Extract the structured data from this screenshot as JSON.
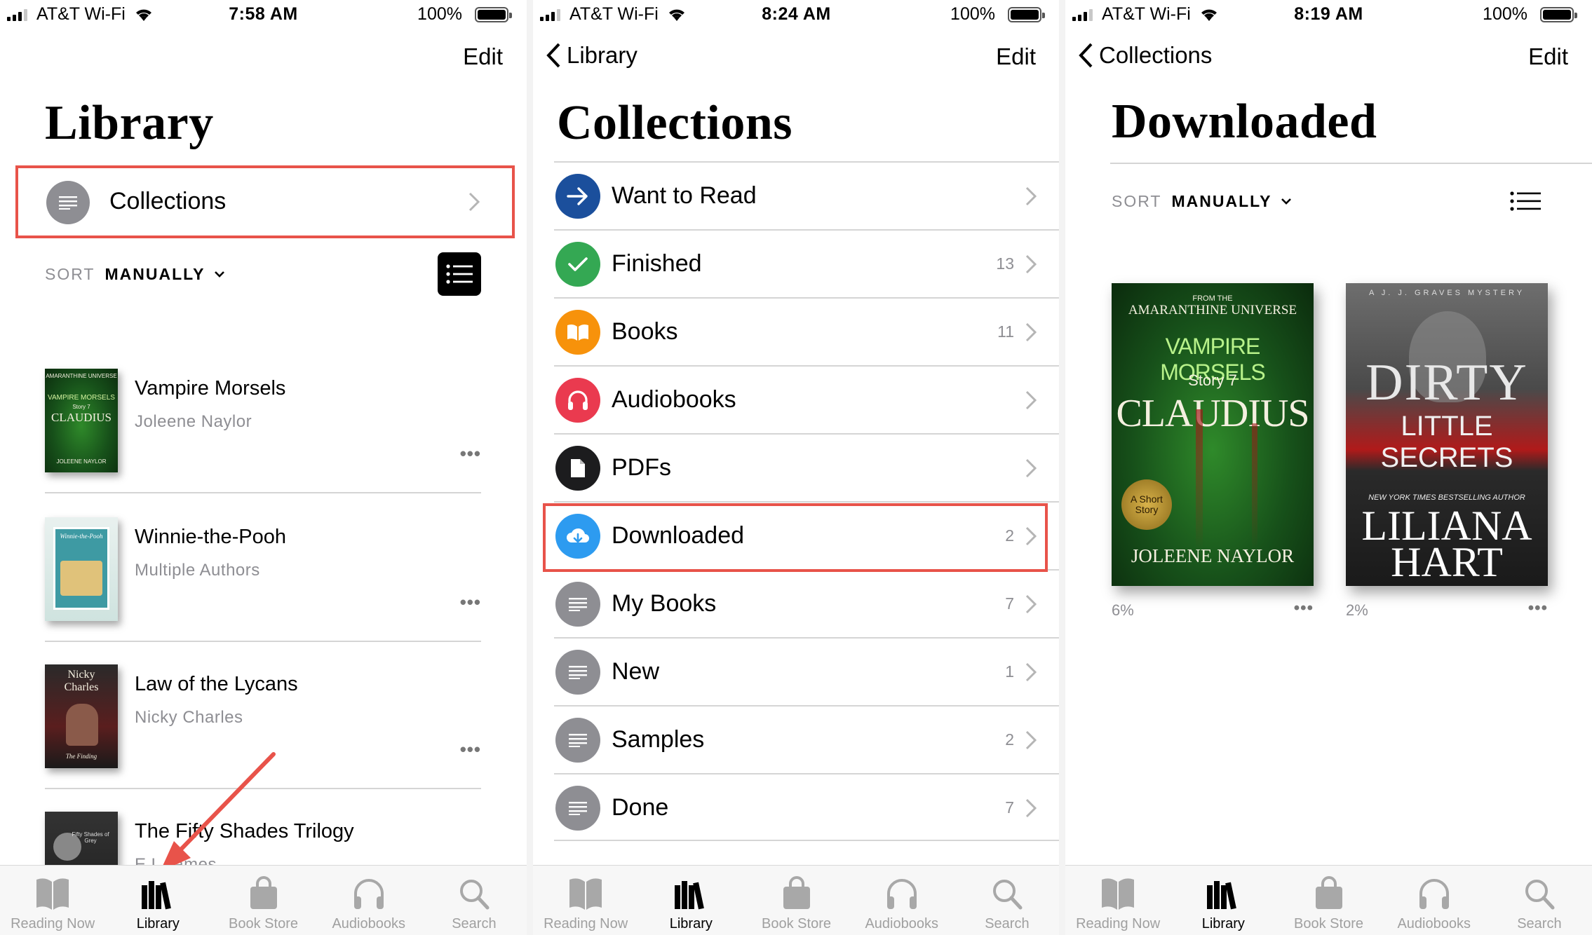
{
  "colors": {
    "highlight": "#e8534a",
    "gray_text": "#8e8e93",
    "separator": "#d5d5d5"
  },
  "panels": [
    {
      "status": {
        "carrier": "AT&T Wi-Fi",
        "time": "7:58 AM",
        "battery": "100%"
      },
      "nav": {
        "edit": "Edit"
      },
      "title": "Library",
      "collections_row": {
        "label": "Collections",
        "icon": "list-icon"
      },
      "sort": {
        "label": "SORT",
        "value": "MANUALLY"
      },
      "books": [
        {
          "title": "Vampire Morsels",
          "author": "Joleene Naylor",
          "more": "•••"
        },
        {
          "title": "Winnie-the-Pooh",
          "author": "Multiple Authors",
          "more": "•••"
        },
        {
          "title": "Law of the Lycans",
          "author": "Nicky Charles",
          "more": "•••"
        },
        {
          "title": "The Fifty Shades Trilogy",
          "author": "E L James",
          "more": "•••"
        }
      ],
      "cover_text": {
        "vampire": {
          "top": "AMARANTHINE UNIVERSE",
          "series": "VAMPIRE MORSELS",
          "story": "Story 7",
          "name": "CLAUDIUS",
          "author": "JOLEENE NAYLOR"
        },
        "winnie": {
          "top": "Winnie-the-Pooh"
        },
        "lycans": {
          "top": "Nicky Charles",
          "bottom": "The Finding"
        },
        "fifty": {
          "top": "Fifty Shades of Grey"
        }
      }
    },
    {
      "status": {
        "carrier": "AT&T Wi-Fi",
        "time": "8:24 AM",
        "battery": "100%"
      },
      "nav": {
        "back": "Library",
        "edit": "Edit"
      },
      "title": "Collections",
      "collections": [
        {
          "label": "Want to Read",
          "count": "",
          "icon": "arrow-right-icon",
          "color": "#1b4f9c"
        },
        {
          "label": "Finished",
          "count": "13",
          "icon": "checkmark-icon",
          "color": "#34a853"
        },
        {
          "label": "Books",
          "count": "11",
          "icon": "open-book-icon",
          "color": "#f7920b"
        },
        {
          "label": "Audiobooks",
          "count": "",
          "icon": "headphones-icon",
          "color": "#ea3a4f"
        },
        {
          "label": "PDFs",
          "count": "",
          "icon": "document-icon",
          "color": "#1c1c1e"
        },
        {
          "label": "Downloaded",
          "count": "2",
          "icon": "cloud-download-icon",
          "color": "#2d9bf0"
        },
        {
          "label": "My Books",
          "count": "7",
          "icon": "list-icon",
          "color": "#8e8e93"
        },
        {
          "label": "New",
          "count": "1",
          "icon": "list-icon",
          "color": "#8e8e93"
        },
        {
          "label": "Samples",
          "count": "2",
          "icon": "list-icon",
          "color": "#8e8e93"
        },
        {
          "label": "Done",
          "count": "7",
          "icon": "list-icon",
          "color": "#8e8e93"
        }
      ]
    },
    {
      "status": {
        "carrier": "AT&T Wi-Fi",
        "time": "8:19 AM",
        "battery": "100%"
      },
      "nav": {
        "back": "Collections",
        "edit": "Edit"
      },
      "title": "Downloaded",
      "sort": {
        "label": "SORT",
        "value": "MANUALLY"
      },
      "books": [
        {
          "progress": "6%",
          "more": "•••",
          "cover": {
            "top": "FROM THE",
            "universe": "AMARANTHINE UNIVERSE",
            "series": "VAMPIRE MORSELS",
            "story": "Story 7",
            "name": "CLAUDIUS",
            "seal": "A Short Story",
            "author": "JOLEENE NAYLOR"
          }
        },
        {
          "progress": "2%",
          "more": "•••",
          "cover": {
            "top": "A J. J. GRAVES MYSTERY",
            "line1": "DIRTY",
            "line2": "LITTLE SECRETS",
            "tag": "NEW YORK TIMES BESTSELLING AUTHOR",
            "author1": "LILIANA",
            "author2": "HART"
          }
        }
      ]
    }
  ],
  "tabbar": [
    {
      "label": "Reading Now",
      "icon": "open-book-icon"
    },
    {
      "label": "Library",
      "icon": "library-books-icon"
    },
    {
      "label": "Book Store",
      "icon": "shopping-bag-icon"
    },
    {
      "label": "Audiobooks",
      "icon": "headphones-icon"
    },
    {
      "label": "Search",
      "icon": "search-icon"
    }
  ]
}
